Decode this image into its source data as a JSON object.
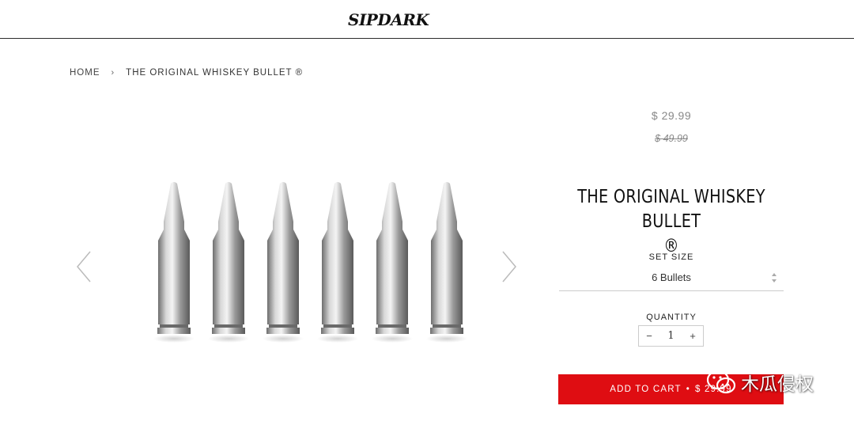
{
  "header": {
    "logo_text": "SIPDARK"
  },
  "breadcrumb": {
    "home": "HOME",
    "separator": "›",
    "current": "THE ORIGINAL WHISKEY BULLET ®"
  },
  "gallery": {
    "prev_icon": "chevron-left-icon",
    "next_icon": "chevron-right-icon",
    "bullet_count": 6
  },
  "product": {
    "price": "$ 29.99",
    "compare_price": "$ 49.99",
    "title_line1": "THE ORIGINAL WHISKEY BULLET",
    "title_line2": "®",
    "size_label": "SET SIZE",
    "size_value": "6 Bullets",
    "quantity_label": "QUANTITY",
    "qty_minus": "−",
    "quantity": "1",
    "qty_plus": "+",
    "add_to_cart_label": "ADD TO CART",
    "add_to_cart_sep": "•",
    "add_to_cart_price": "$ 29.99"
  },
  "watermark": {
    "text": "木瓜侵权",
    "icon": "wechat-icon"
  },
  "colors": {
    "accent": "#df0d12",
    "text": "#222222",
    "muted": "#888888"
  }
}
